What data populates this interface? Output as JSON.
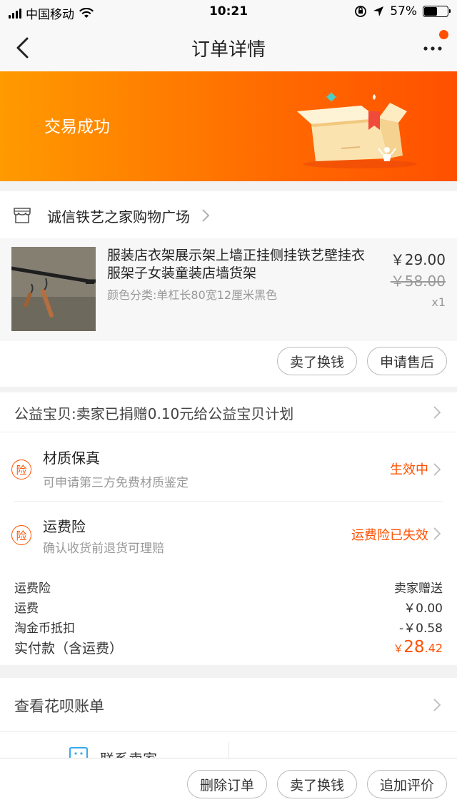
{
  "status_bar": {
    "carrier": "中国移动",
    "time": "10:21",
    "battery_percent": "57%",
    "battery_level": 0.57
  },
  "nav": {
    "title": "订单详情"
  },
  "banner": {
    "status_text": "交易成功"
  },
  "store": {
    "name": "诚信铁艺之家购物广场"
  },
  "product": {
    "title": "服装店衣架展示架上墙正挂侧挂铁艺壁挂衣服架子女装童装店墙货架",
    "spec": "颜色分类:单杠长80宽12厘米黑色",
    "price_now": "￥29.00",
    "price_old": "￥58.00",
    "quantity": "x1"
  },
  "item_actions": {
    "sell_label": "卖了换钱",
    "aftersale_label": "申请售后"
  },
  "charity": {
    "text": "公益宝贝:卖家已捐赠0.10元给公益宝贝计划"
  },
  "insurance": [
    {
      "badge": "险",
      "title": "材质保真",
      "subtitle": "可申请第三方免费材质鉴定",
      "status": "生效中"
    },
    {
      "badge": "险",
      "title": "运费险",
      "subtitle": "确认收货前退货可理赔",
      "status": "运费险已失效"
    }
  ],
  "fees": [
    {
      "label": "运费险",
      "value": "卖家赠送"
    },
    {
      "label": "运费",
      "value": "￥0.00"
    },
    {
      "label": "淘金币抵扣",
      "value": "-￥0.58"
    }
  ],
  "total": {
    "label": "实付款（含运费）",
    "currency": "￥",
    "integer": "28",
    "decimal": ".42"
  },
  "huabei": {
    "text": "查看花呗账单"
  },
  "contact": {
    "seller_label": "联系卖家"
  },
  "bottom_actions": {
    "delete_label": "删除订单",
    "sell_label": "卖了换钱",
    "review_label": "追加评价"
  },
  "colors": {
    "accent": "#ff5000",
    "banner_start": "#ff9a00",
    "banner_end": "#ff5000"
  }
}
